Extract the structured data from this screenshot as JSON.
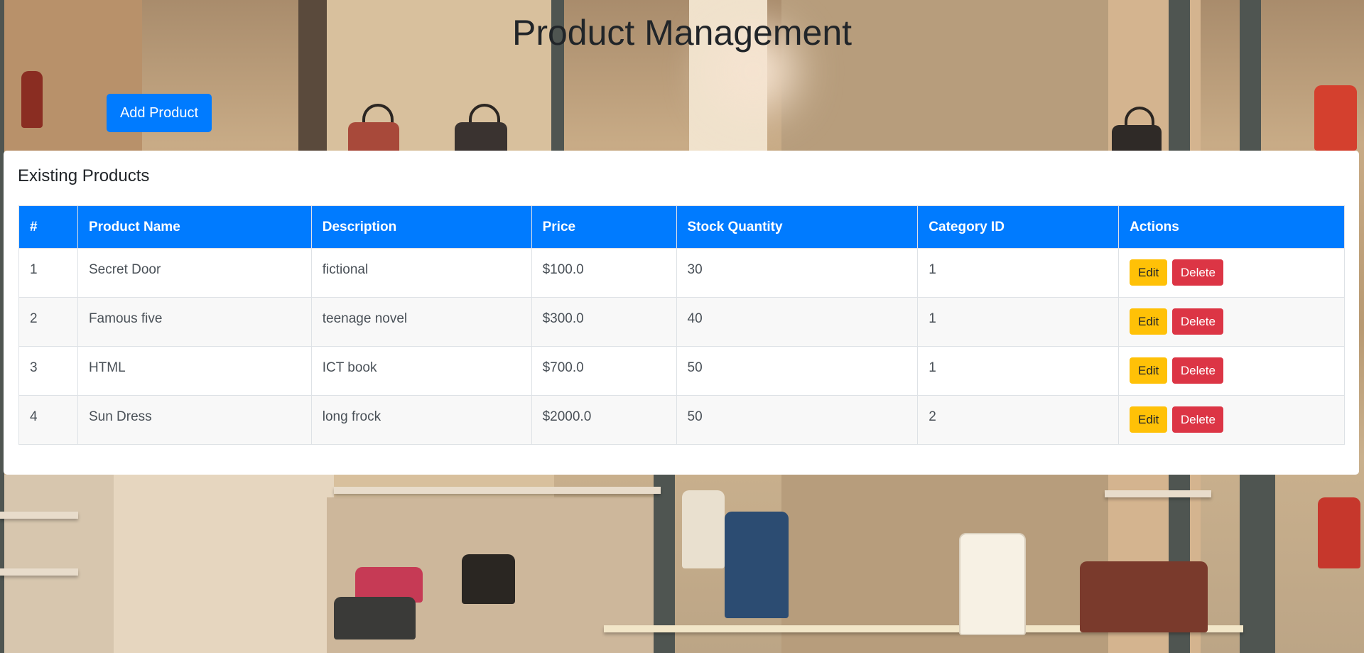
{
  "header": {
    "title": "Product Management",
    "add_button_label": "Add Product"
  },
  "card": {
    "title": "Existing Products"
  },
  "table": {
    "columns": [
      "#",
      "Product Name",
      "Description",
      "Price",
      "Stock Quantity",
      "Category ID",
      "Actions"
    ],
    "rows": [
      {
        "id": "1",
        "name": "Secret Door",
        "description": "fictional",
        "price": "$100.0",
        "stock": "30",
        "category": "1"
      },
      {
        "id": "2",
        "name": "Famous five",
        "description": "teenage novel",
        "price": "$300.0",
        "stock": "40",
        "category": "1"
      },
      {
        "id": "3",
        "name": "HTML",
        "description": "ICT book",
        "price": "$700.0",
        "stock": "50",
        "category": "1"
      },
      {
        "id": "4",
        "name": "Sun Dress",
        "description": "long frock",
        "price": "$2000.0",
        "stock": "50",
        "category": "2"
      }
    ],
    "edit_label": "Edit",
    "delete_label": "Delete"
  },
  "colors": {
    "primary": "#007bff",
    "warning": "#ffc107",
    "danger": "#dc3545"
  }
}
